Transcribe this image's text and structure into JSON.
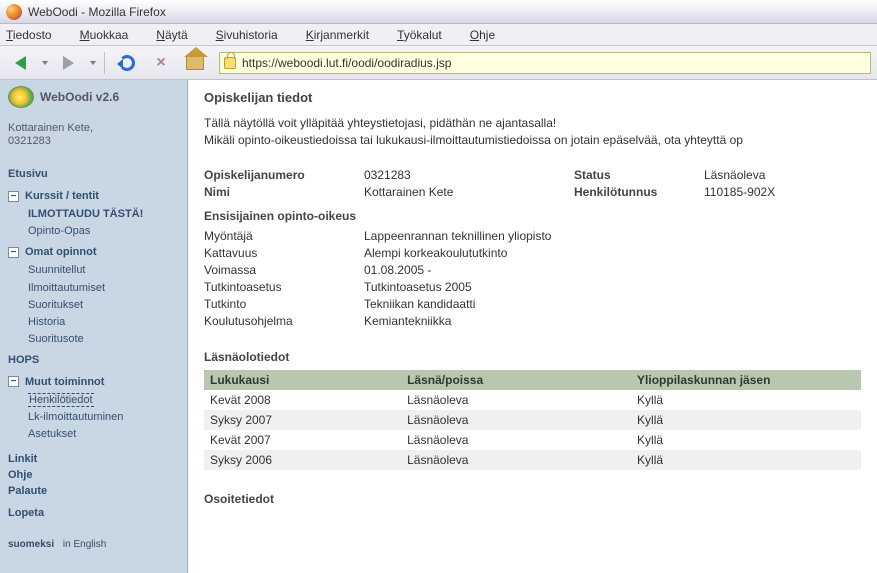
{
  "window": {
    "title": "WebOodi - Mozilla Firefox"
  },
  "menubar": {
    "items": [
      "Tiedosto",
      "Muokkaa",
      "Näytä",
      "Sivuhistoria",
      "Kirjanmerkit",
      "Työkalut",
      "Ohje"
    ]
  },
  "url": "https://weboodi.lut.fi/oodi/oodiradius.jsp",
  "sidebar": {
    "app_name": "WebOodi v2.6",
    "user_name": "Kottarainen Kete,",
    "user_no": "0321283",
    "links_front": "Etusivu",
    "groups": [
      {
        "label": "Kurssit / tentit",
        "items": [
          "ILMOTTAUDU TÄSTÄ!",
          "Opinto-Opas"
        ]
      },
      {
        "label": "Omat opinnot",
        "items": [
          "Suunnitellut",
          "Ilmoittautumiset",
          "Suoritukset",
          "Historia",
          "Suoritusote"
        ]
      }
    ],
    "hops": "HOPS",
    "group_muut": {
      "label": "Muut toiminnot",
      "items": [
        "Henkilötiedot",
        "Lk-ilmoittautuminen",
        "Asetukset"
      ]
    },
    "bottom": [
      "Linkit",
      "Ohje",
      "Palaute"
    ],
    "logout": "Lopeta",
    "lang": {
      "fi": "suomeksi",
      "en": "in English"
    }
  },
  "page": {
    "title": "Opiskelijan tiedot",
    "intro1": "Tällä näytöllä voit ylläpitää yhteystietojasi, pidäthän ne ajantasalla!",
    "intro2": "Mikäli opinto-oikeustiedoissa tai lukukausi-ilmoittautumistiedoissa on jotain epäselvää, ota yhteyttä op",
    "ident": {
      "snum_lbl": "Opiskelijanumero",
      "snum": "0321283",
      "status_lbl": "Status",
      "status": "Läsnäoleva",
      "name_lbl": "Nimi",
      "name": "Kottarainen Kete",
      "pid_lbl": "Henkilötunnus",
      "pid": "110185-902X"
    },
    "rights_title": "Ensisijainen opinto-oikeus",
    "rights": {
      "granter_lbl": "Myöntäjä",
      "granter": "Lappeenrannan teknillinen yliopisto",
      "cover_lbl": "Kattavuus",
      "cover": "Alempi korkeakoulututkinto",
      "valid_lbl": "Voimassa",
      "valid": "01.08.2005 -",
      "decree_lbl": "Tutkintoasetus",
      "decree": "Tutkintoasetus 2005",
      "degree_lbl": "Tutkinto",
      "degree": "Tekniikan kandidaatti",
      "prog_lbl": "Koulutusohjelma",
      "prog": "Kemiantekniikka"
    },
    "att_title": "Läsnäolotiedot",
    "att_cols": {
      "c1": "Lukukausi",
      "c2": "Läsnä/poissa",
      "c3": "Ylioppilaskunnan jäsen"
    },
    "att_rows": [
      {
        "term": "Kevät 2008",
        "status": "Läsnäoleva",
        "union": "Kyllä"
      },
      {
        "term": "Syksy 2007",
        "status": "Läsnäoleva",
        "union": "Kyllä"
      },
      {
        "term": "Kevät 2007",
        "status": "Läsnäoleva",
        "union": "Kyllä"
      },
      {
        "term": "Syksy 2006",
        "status": "Läsnäoleva",
        "union": "Kyllä"
      }
    ],
    "addr_title": "Osoitetiedot"
  }
}
